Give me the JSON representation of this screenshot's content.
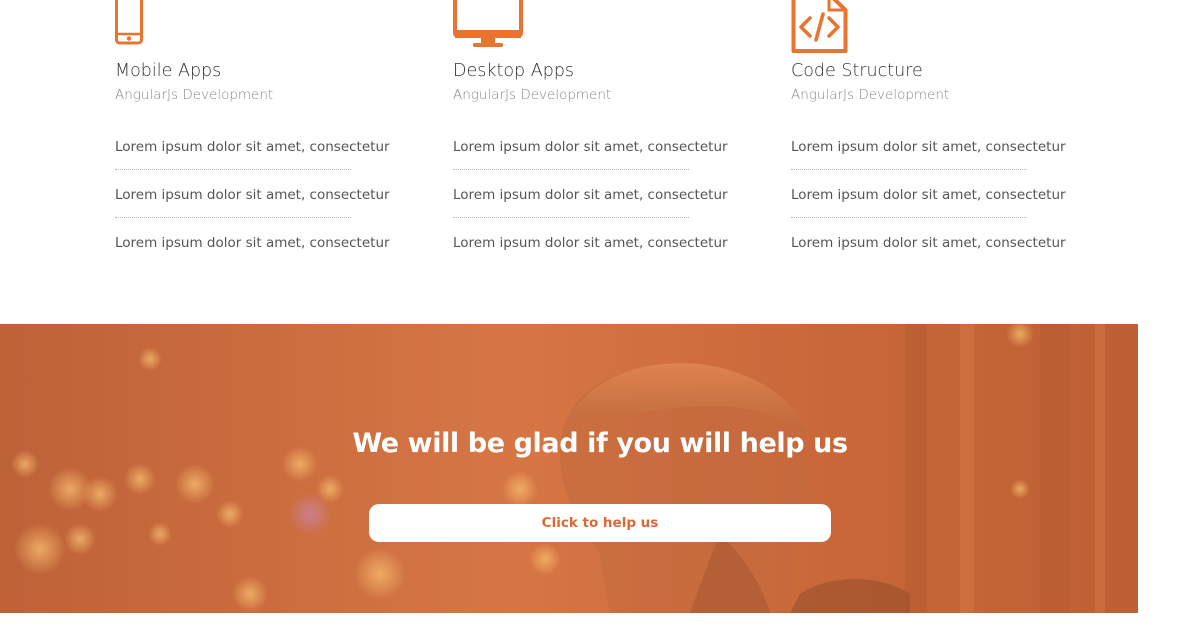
{
  "colors": {
    "accent": "#e8742f",
    "cta_overlay": "#d06a3a",
    "cta_button_text": "#d96a35"
  },
  "services": [
    {
      "icon": "mobile-phone-icon",
      "title": "Mobile Apps",
      "subtitle": "AngularJs Development",
      "features": [
        "Lorem ipsum dolor sit amet, consectetur",
        "Lorem ipsum dolor sit amet, consectetur",
        "Lorem ipsum dolor sit amet, consectetur"
      ]
    },
    {
      "icon": "desktop-monitor-icon",
      "title": "Desktop Apps",
      "subtitle": "AngularJs Development",
      "features": [
        "Lorem ipsum dolor sit amet, consectetur",
        "Lorem ipsum dolor sit amet, consectetur",
        "Lorem ipsum dolor sit amet, consectetur"
      ]
    },
    {
      "icon": "code-file-icon",
      "title": "Code Structure",
      "subtitle": "AngularJs Development",
      "features": [
        "Lorem ipsum dolor sit amet, consectetur",
        "Lorem ipsum dolor sit amet, consectetur",
        "Lorem ipsum dolor sit amet, consectetur"
      ]
    }
  ],
  "cta": {
    "title": "We will be glad if you will help us",
    "button_label": "Click to help us"
  }
}
